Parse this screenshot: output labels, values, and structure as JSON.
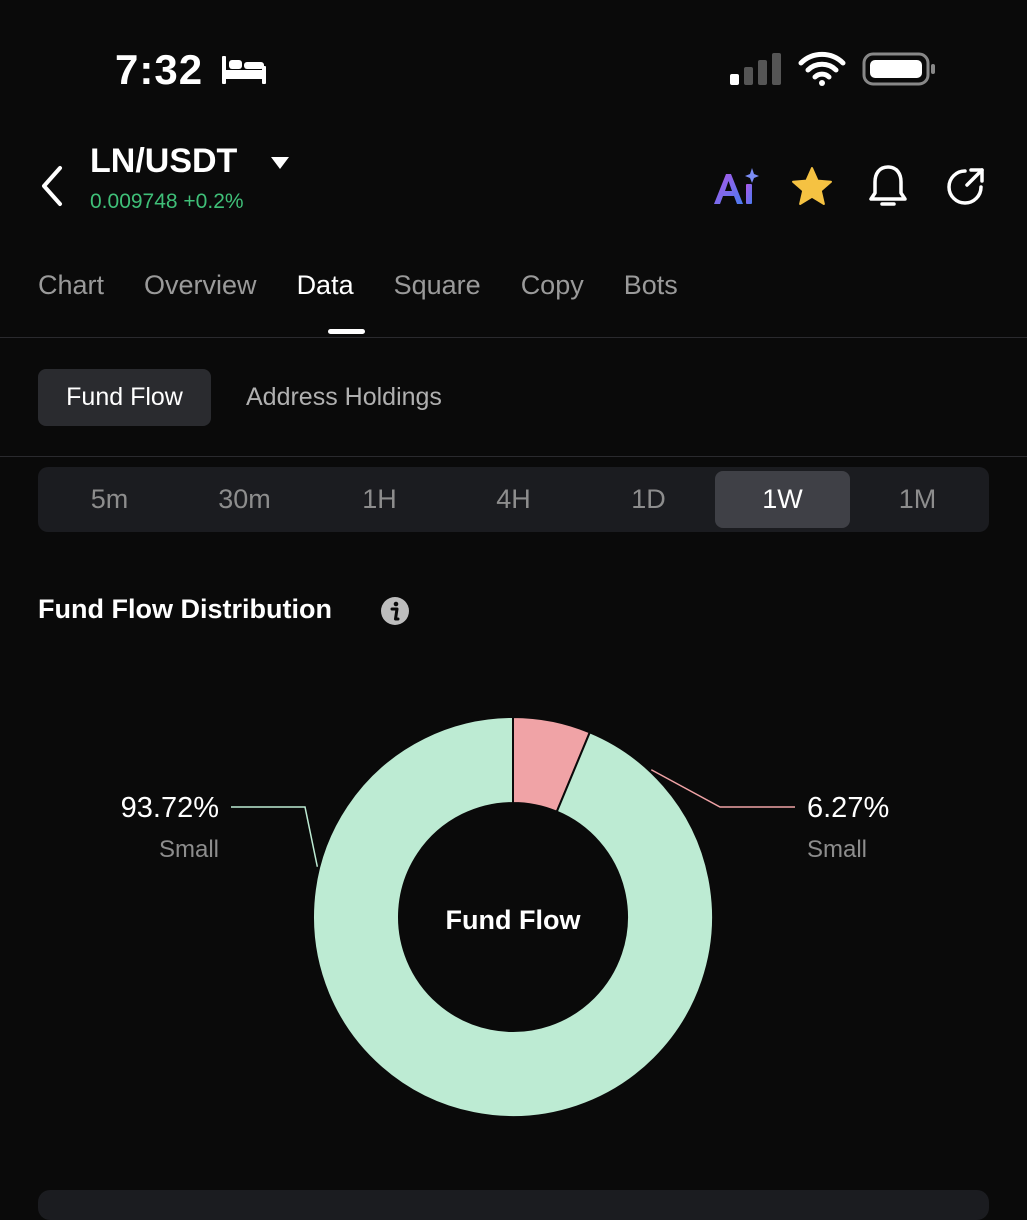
{
  "status_bar": {
    "time": "7:32",
    "icons": [
      "bed-icon",
      "signal-icon",
      "wifi-icon",
      "battery-icon"
    ]
  },
  "header": {
    "pair": "LN/USDT",
    "price_change": "0.009748 +0.2%",
    "icons": [
      "back-icon",
      "ai-icon",
      "star-icon",
      "bell-icon",
      "share-icon"
    ],
    "colors": {
      "price_green": "#3fbf78",
      "star": "#f5c242"
    }
  },
  "tabs": [
    {
      "label": "Chart"
    },
    {
      "label": "Overview"
    },
    {
      "label": "Data"
    },
    {
      "label": "Square"
    },
    {
      "label": "Copy"
    },
    {
      "label": "Bots"
    }
  ],
  "active_tab": "Data",
  "subtabs": {
    "active": "Fund Flow",
    "other": "Address Holdings"
  },
  "intervals": [
    {
      "label": "5m"
    },
    {
      "label": "30m"
    },
    {
      "label": "1H"
    },
    {
      "label": "4H"
    },
    {
      "label": "1D"
    },
    {
      "label": "1W"
    },
    {
      "label": "1M"
    }
  ],
  "active_interval": "1W",
  "section": {
    "title": "Fund Flow Distribution"
  },
  "chart_data": {
    "type": "pie",
    "center_label": "Fund Flow",
    "slices": [
      {
        "label": "Small",
        "value": 6.27,
        "display": "6.27%",
        "color": "#f0a3a6"
      },
      {
        "label": "Small",
        "value": 93.72,
        "display": "93.72%",
        "color": "#bdebd3"
      }
    ]
  }
}
